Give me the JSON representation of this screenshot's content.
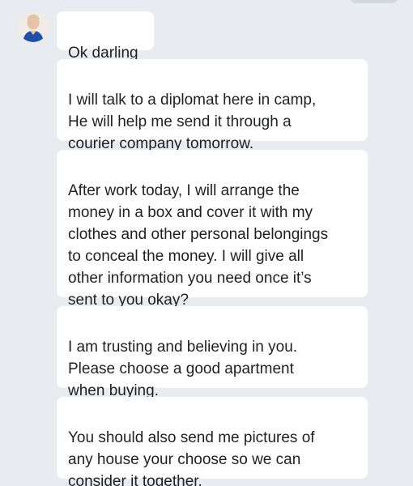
{
  "conversation": {
    "messages": [
      {
        "text": "Ok darling"
      },
      {
        "text": "I will talk to a diplomat here in camp,\nHe will help me send it through a\ncourier company tomorrow."
      },
      {
        "text": "After work today, I will arrange the\nmoney in a box and cover it with my\nclothes and other personal belongings\nto conceal the money. I will give all\nother information you need once it’s\nsent to you okay?"
      },
      {
        "text": "I am trusting and believing in you.\nPlease choose a good apartment\nwhen buying."
      },
      {
        "text": "You should also send me pictures of\nany house your choose so we can\nconsider it together."
      }
    ]
  },
  "colors": {
    "background": "#e8ecf0",
    "bubble": "#ffffff",
    "text": "#1e2022"
  }
}
